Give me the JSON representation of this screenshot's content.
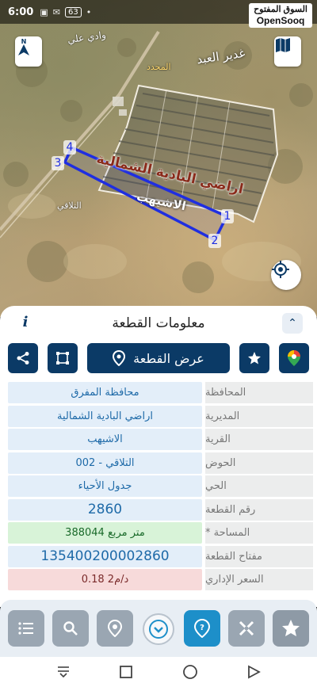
{
  "status_bar": {
    "time": "6:00",
    "battery_badge": "63"
  },
  "watermark": {
    "arabic": "السوق المفتوح",
    "brand": "OpenSooq"
  },
  "map": {
    "labels": {
      "wadi_ali": "وادي علي",
      "ghadir_al_abd": "غدير العبد",
      "al_muhaddad": "المحدد",
      "area_name": "اراضي البادية الشمالية",
      "village": "الاشيهب",
      "basin": "التلاقي"
    },
    "vertices": [
      "1",
      "2",
      "3",
      "4"
    ]
  },
  "panel": {
    "title": "معلومات القطعة",
    "show_parcel_label": "عرض القطعة"
  },
  "fields": [
    {
      "label": "المحافظة",
      "value": "محافظة المفرق"
    },
    {
      "label": "المديرية",
      "value": "اراضي البادية الشمالية"
    },
    {
      "label": "القرية",
      "value": "الاشيهب"
    },
    {
      "label": "الحوض",
      "value": "التلاقي - 002"
    },
    {
      "label": "الحي",
      "value": "جدول الأحياء"
    },
    {
      "label": "رقم القطعة",
      "value": "2860"
    },
    {
      "label": "المساحة *",
      "value": "388044 متر مربع"
    },
    {
      "label": "مفتاح القطعة",
      "value": "135400200002860"
    },
    {
      "label": "السعر الإداري",
      "value": "0.18 د/م2"
    }
  ],
  "colors": {
    "primary": "#0b3a66",
    "accent": "#1d8fc9",
    "parcel_outline": "#1f2ee0",
    "value_bg": "#e3eef9",
    "area_bg": "#d8f3d8",
    "price_bg": "#f7dada"
  },
  "icons": {
    "compass": "compass-icon",
    "map_toggle": "map-icon",
    "locate": "crosshair-icon",
    "info": "info-icon",
    "collapse": "chevron-up-icon",
    "share": "share-icon",
    "measure": "polygon-icon",
    "pin": "pin-icon",
    "star": "star-icon",
    "google_maps": "google-maps-icon",
    "list": "list-icon",
    "search": "search-icon",
    "location_pin": "location-pin-icon",
    "chevron_down": "chevron-down-icon",
    "help_pin": "help-pin-icon",
    "cross": "cross-tools-icon"
  }
}
